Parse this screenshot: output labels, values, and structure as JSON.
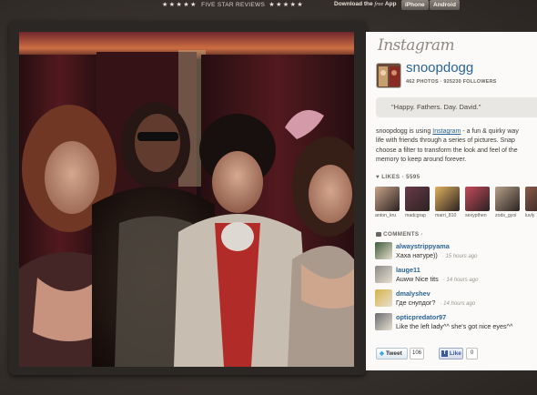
{
  "topbar": {
    "stars_left": "★★★★★",
    "reviews_label": "FIVE STAR REVIEWS",
    "stars_right": "★★★★★",
    "download_prefix": "Download the ",
    "download_free": "free",
    "download_suffix": " App",
    "iphone_label": "iPhone",
    "android_label": "Android"
  },
  "panel": {
    "logo": "Instagram",
    "username": "snoopdogg",
    "stats": "462 PHOTOS · 925230 FOLLOWERS",
    "caption": "\"Happy. Fathers. Day. David.\"",
    "desc_prefix": "snoopdogg is using ",
    "desc_link": "Instagram",
    "desc_line1_suffix": " - a fun & quirky way",
    "desc_line2": "life with friends through a series of pictures. Snap",
    "desc_line3": "choose a filter to transform the look and feel of the",
    "desc_line4": "memory to keep around forever.",
    "likes_label": "LIKES · 5595",
    "comments_label": "COMMENTS ·",
    "likers": [
      {
        "name": "anton_kru",
        "color": "#c9a48a"
      },
      {
        "name": "madcgrap",
        "color": "#6a3a4a"
      },
      {
        "name": "marri_810",
        "color": "#e0b060"
      },
      {
        "name": "sexypthen",
        "color": "#c44a5a"
      },
      {
        "name": "zods_gyoi",
        "color": "#b7a089"
      },
      {
        "name": "luvly",
        "color": "#8a5a4a"
      }
    ],
    "comments": [
      {
        "user": "alwaystrippyama",
        "text": "Хаха натуре))",
        "time": "15 hours ago",
        "color": "#3c5a3a"
      },
      {
        "user": "lauge11",
        "text": "Auww Nice tits",
        "time": "14 hours ago",
        "color": "#8a8a88"
      },
      {
        "user": "dmalyshev",
        "text": "Где снупдог?",
        "time": "14 hours ago",
        "color": "#d6b24a"
      },
      {
        "user": "opticpredator97",
        "text": "Like the left lady^^ she's got nice eyes^^",
        "time": "",
        "color": "#6a6a70"
      }
    ],
    "tweet_label": "Tweet",
    "tweet_count": "106",
    "like_label": "Like",
    "like_count": "0"
  },
  "colors": {
    "link": "#2a6496",
    "background": "#3a3430",
    "panel": "#fbfaf8"
  }
}
